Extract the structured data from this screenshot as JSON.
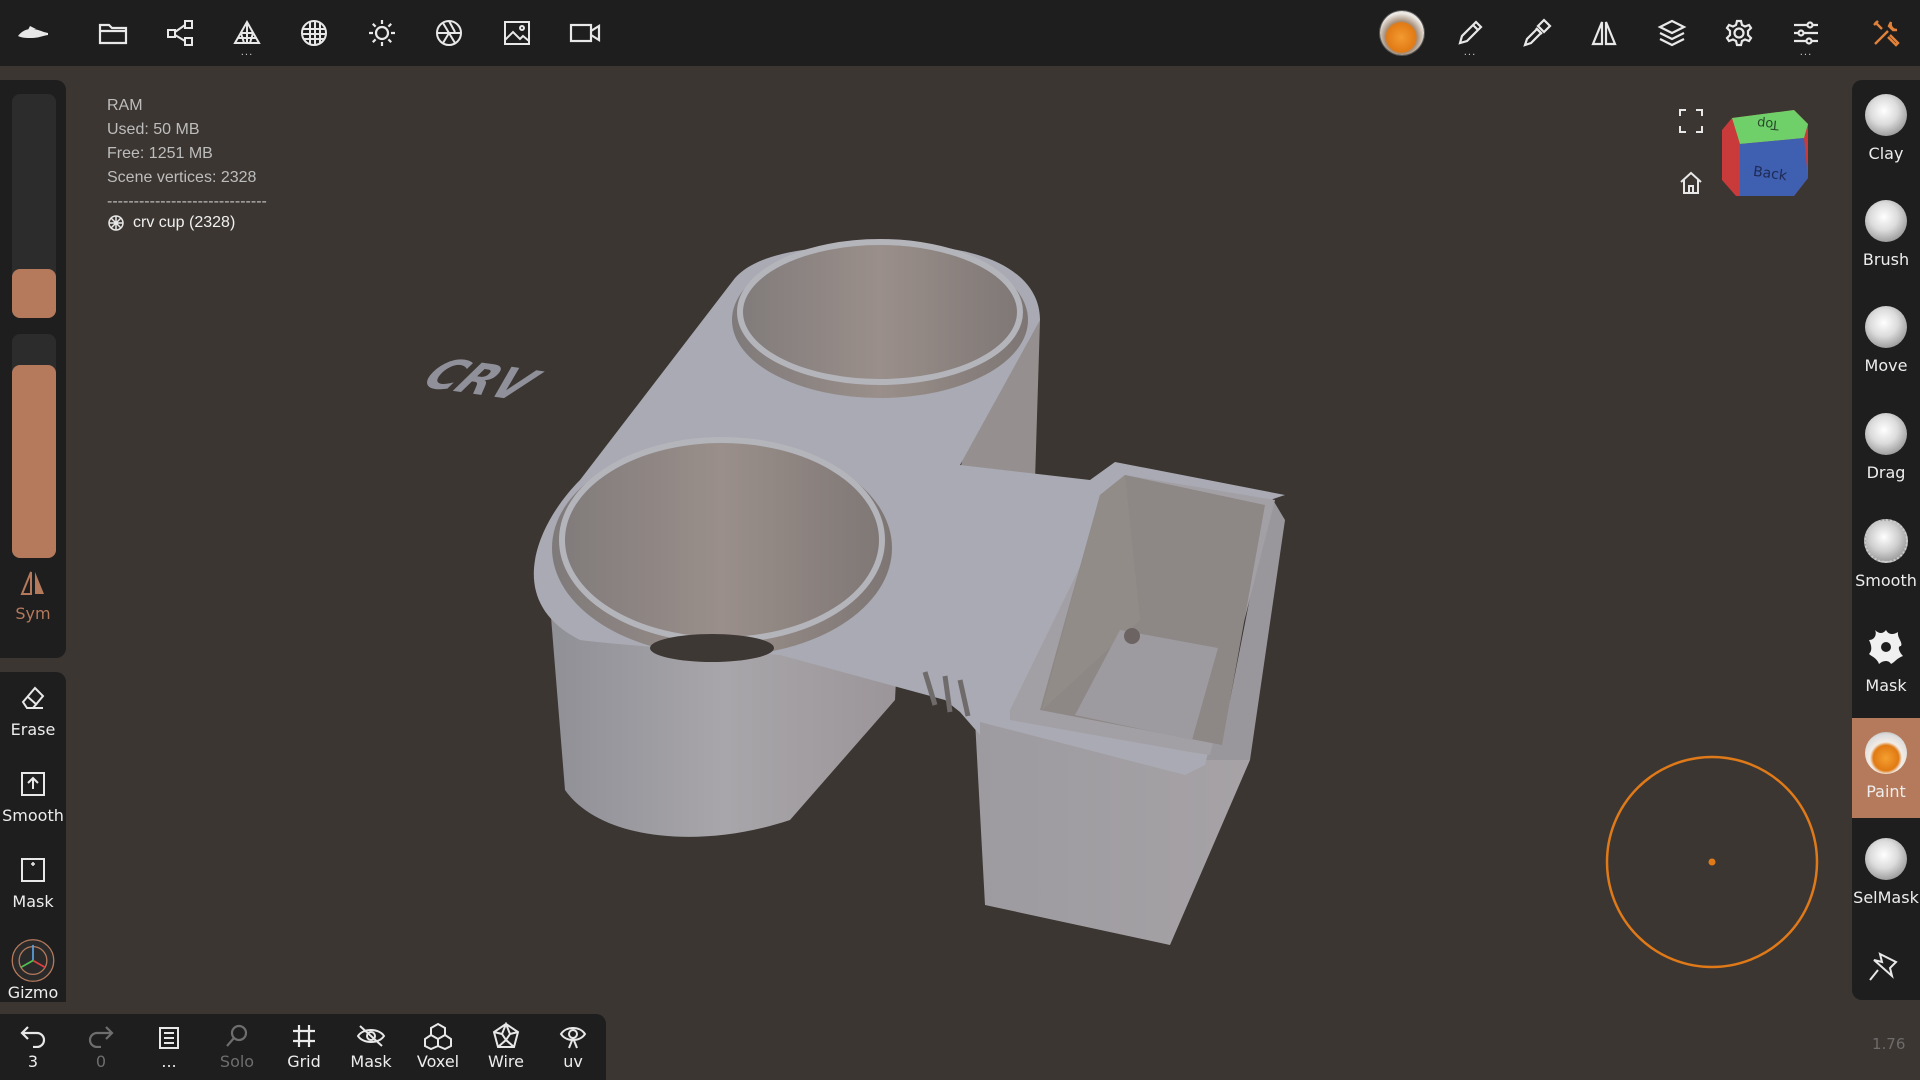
{
  "topbar": {
    "left_icons": [
      "app-logo-icon",
      "folder-icon",
      "scene-graph-icon",
      "topology-icon",
      "material-icon",
      "light-icon",
      "camera-aperture-icon",
      "image-icon",
      "video-camera-icon"
    ],
    "right_icons": [
      "paint-material-sphere-icon",
      "pen-icon",
      "picker-icon",
      "symmetry-icon",
      "layers-icon",
      "settings-icon",
      "sliders-icon",
      "tools-icon"
    ],
    "more_dots": "..."
  },
  "info": {
    "ram_label": "RAM",
    "used": "Used: 50 MB",
    "free": "Free: 1251 MB",
    "vertices": "Scene vertices: 2328",
    "separator": "------------------------------",
    "object": "crv cup (2328)"
  },
  "left": {
    "radius_level": 0.22,
    "intensity_level": 0.86,
    "sym_label": "Sym",
    "erase_label": "Erase",
    "smooth_label": "Smooth",
    "mask_label": "Mask",
    "gizmo_label": "Gizmo"
  },
  "right_tools": [
    {
      "label": "Clay"
    },
    {
      "label": "Brush"
    },
    {
      "label": "Move"
    },
    {
      "label": "Drag"
    },
    {
      "label": "Smooth"
    },
    {
      "label": "Mask"
    },
    {
      "label": "Paint"
    },
    {
      "label": "SelMask"
    }
  ],
  "bottom": {
    "undo_count": "3",
    "redo_count": "0",
    "more_label": "...",
    "solo_label": "Solo",
    "grid_label": "Grid",
    "mask_label": "Mask",
    "voxel_label": "Voxel",
    "wire_label": "Wire",
    "uv_label": "uv"
  },
  "view_cube": {
    "top": "Top",
    "front": "Back"
  },
  "model_text": "CRV",
  "version": "1.76",
  "colors": {
    "accent": "#b57a5c",
    "brush_ring": "#e07a18",
    "background": "#3b3632",
    "panel": "#1e1e1e"
  }
}
